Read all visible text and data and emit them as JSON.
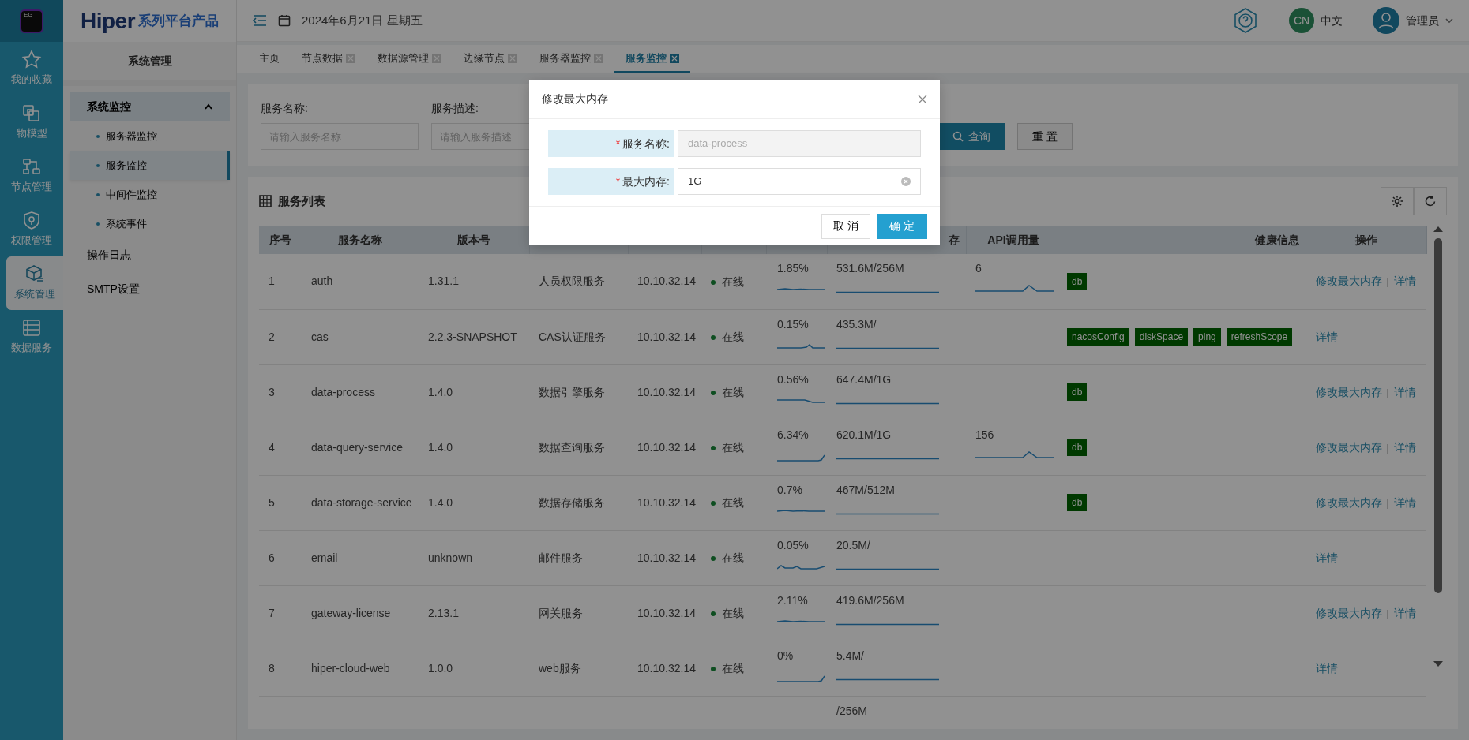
{
  "rail": {
    "logo_text": "EG",
    "items": [
      {
        "label": "我的收藏",
        "selected": false
      },
      {
        "label": "物模型",
        "selected": false
      },
      {
        "label": "节点管理",
        "selected": false
      },
      {
        "label": "权限管理",
        "selected": false
      },
      {
        "label": "系统管理",
        "selected": true
      },
      {
        "label": "数据服务",
        "selected": false
      }
    ]
  },
  "brand": {
    "name": "Hiper",
    "tagline": "系列平台产品"
  },
  "sidebar": {
    "title": "系统管理",
    "items": [
      {
        "label": "系统监控",
        "expanded": true,
        "children": [
          {
            "label": "服务器监控",
            "selected": false
          },
          {
            "label": "服务监控",
            "selected": true
          },
          {
            "label": "中间件监控",
            "selected": false
          },
          {
            "label": "系统事件",
            "selected": false
          }
        ]
      },
      {
        "label": "操作日志"
      },
      {
        "label": "SMTP设置"
      }
    ]
  },
  "header": {
    "date": "2024年6月21日 星期五",
    "language_code": "CN",
    "language": "中文",
    "user": "管理员"
  },
  "tabs": [
    {
      "label": "主页",
      "closable": false,
      "selected": false
    },
    {
      "label": "节点数据",
      "closable": true,
      "selected": false
    },
    {
      "label": "数据源管理",
      "closable": true,
      "selected": false
    },
    {
      "label": "边缘节点",
      "closable": true,
      "selected": false
    },
    {
      "label": "服务器监控",
      "closable": true,
      "selected": false
    },
    {
      "label": "服务监控",
      "closable": true,
      "selected": true
    }
  ],
  "search": {
    "fields": [
      {
        "label": "服务名称:",
        "placeholder": "请输入服务名称"
      },
      {
        "label": "服务描述:",
        "placeholder": "请输入服务描述"
      }
    ],
    "query_button": "查询",
    "reset_button": "重 置"
  },
  "table": {
    "title": "服务列表",
    "action_separator": "|",
    "columns": [
      {
        "label": "序号"
      },
      {
        "label": "服务名称"
      },
      {
        "label": "版本号"
      },
      {},
      {},
      {},
      {},
      {
        "label": "存"
      },
      {
        "label": "API调用量"
      },
      {
        "label": "健康信息"
      },
      {
        "label": "操作"
      }
    ],
    "rows": [
      {
        "index": "1",
        "name": "auth",
        "version": "1.31.1",
        "description": "人员权限服务",
        "ip": "10.10.32.14",
        "status": "在线",
        "cpu": "1.85%",
        "memory": "531.6M/256M",
        "api": "6",
        "health": [
          "db"
        ],
        "actions": [
          "修改最大内存",
          "详情"
        ]
      },
      {
        "index": "2",
        "name": "cas",
        "version": "2.2.3-SNAPSHOT",
        "description": "CAS认证服务",
        "ip": "10.10.32.14",
        "status": "在线",
        "cpu": "0.15%",
        "memory": "435.3M/",
        "health": [
          "nacosConfig",
          "diskSpace",
          "ping",
          "refreshScope"
        ],
        "actions": [
          "详情"
        ]
      },
      {
        "index": "3",
        "name": "data-process",
        "version": "1.4.0",
        "description": "数据引擎服务",
        "ip": "10.10.32.14",
        "status": "在线",
        "cpu": "0.56%",
        "memory": "647.4M/1G",
        "health": [
          "db"
        ],
        "actions": [
          "修改最大内存",
          "详情"
        ]
      },
      {
        "index": "4",
        "name": "data-query-service",
        "version": "1.4.0",
        "description": "数据查询服务",
        "ip": "10.10.32.14",
        "status": "在线",
        "cpu": "6.34%",
        "memory": "620.1M/1G",
        "api": "156",
        "health": [
          "db"
        ],
        "actions": [
          "修改最大内存",
          "详情"
        ]
      },
      {
        "index": "5",
        "name": "data-storage-service",
        "version": "1.4.0",
        "description": "数据存储服务",
        "ip": "10.10.32.14",
        "status": "在线",
        "cpu": "0.7%",
        "memory": "467M/512M",
        "health": [
          "db"
        ],
        "actions": [
          "修改最大内存",
          "详情"
        ]
      },
      {
        "index": "6",
        "name": "email",
        "version": "unknown",
        "description": "邮件服务",
        "ip": "10.10.32.14",
        "status": "在线",
        "cpu": "0.05%",
        "memory": "20.5M/",
        "actions": [
          "详情"
        ]
      },
      {
        "index": "7",
        "name": "gateway-license",
        "version": "2.13.1",
        "description": "网关服务",
        "ip": "10.10.32.14",
        "status": "在线",
        "cpu": "2.11%",
        "memory": "419.6M/256M",
        "actions": [
          "修改最大内存",
          "详情"
        ]
      },
      {
        "index": "8",
        "name": "hiper-cloud-web",
        "version": "1.0.0",
        "description": "web服务",
        "ip": "10.10.32.14",
        "status": "在线",
        "cpu": "0%",
        "memory": "5.4M/",
        "actions": [
          "详情"
        ]
      },
      {
        "memory": "/256M"
      }
    ]
  },
  "dialog": {
    "title": "修改最大内存",
    "fields": [
      {
        "required_mark": "*",
        "label": "服务名称:",
        "value": "data-process",
        "disabled": true,
        "clearable": false
      },
      {
        "required_mark": "*",
        "label": "最大内存:",
        "value": "1G",
        "disabled": false,
        "clearable": true
      }
    ],
    "cancel_button": "取 消",
    "confirm_button": "确 定"
  }
}
